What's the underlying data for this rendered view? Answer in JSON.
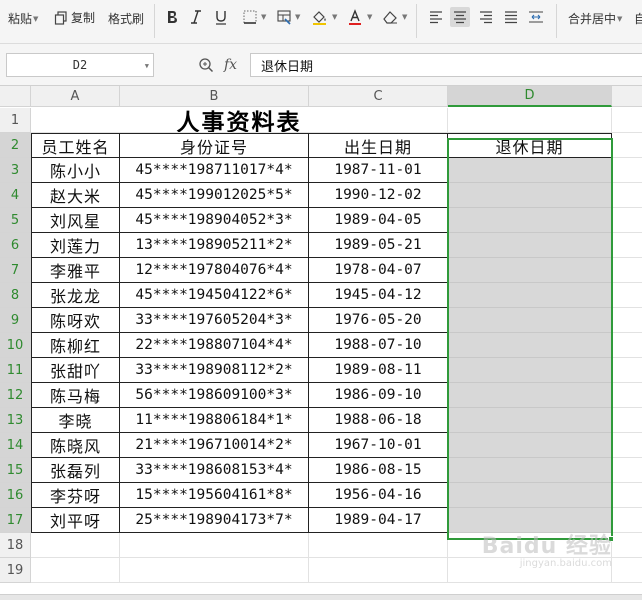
{
  "toolbar": {
    "paste_label": "粘贴",
    "copy_label": "复制",
    "format_painter_label": "格式刷",
    "merge_center_label": "合并居中",
    "overflow_label": "自"
  },
  "formula_bar": {
    "cell_ref": "D2",
    "fx_label": "fx",
    "content": "退休日期"
  },
  "columns": [
    "A",
    "B",
    "C",
    "D"
  ],
  "selected_column": "D",
  "rows": [
    "1",
    "2",
    "3",
    "4",
    "5",
    "6",
    "7",
    "8",
    "9",
    "10",
    "11",
    "12",
    "13",
    "14",
    "15",
    "16",
    "17",
    "18",
    "19"
  ],
  "sheet": {
    "title": "人事资料表",
    "headers": [
      "员工姓名",
      "身份证号",
      "出生日期",
      "退休日期"
    ],
    "records": [
      {
        "name": "陈小小",
        "id": "45****198711017*4*",
        "birth": "1987-11-01",
        "retire": ""
      },
      {
        "name": "赵大米",
        "id": "45****199012025*5*",
        "birth": "1990-12-02",
        "retire": ""
      },
      {
        "name": "刘风星",
        "id": "45****198904052*3*",
        "birth": "1989-04-05",
        "retire": ""
      },
      {
        "name": "刘莲力",
        "id": "13****198905211*2*",
        "birth": "1989-05-21",
        "retire": ""
      },
      {
        "name": "李雅平",
        "id": "12****197804076*4*",
        "birth": "1978-04-07",
        "retire": ""
      },
      {
        "name": "张龙龙",
        "id": "45****194504122*6*",
        "birth": "1945-04-12",
        "retire": ""
      },
      {
        "name": "陈呀欢",
        "id": "33****197605204*3*",
        "birth": "1976-05-20",
        "retire": ""
      },
      {
        "name": "陈柳红",
        "id": "22****198807104*4*",
        "birth": "1988-07-10",
        "retire": ""
      },
      {
        "name": "张甜吖",
        "id": "33****198908112*2*",
        "birth": "1989-08-11",
        "retire": ""
      },
      {
        "name": "陈马梅",
        "id": "56****198609100*3*",
        "birth": "1986-09-10",
        "retire": ""
      },
      {
        "name": "李晓",
        "id": "11****198806184*1*",
        "birth": "1988-06-18",
        "retire": ""
      },
      {
        "name": "陈晓风",
        "id": "21****196710014*2*",
        "birth": "1967-10-01",
        "retire": ""
      },
      {
        "name": "张磊列",
        "id": "33****198608153*4*",
        "birth": "1986-08-15",
        "retire": ""
      },
      {
        "name": "李芬呀",
        "id": "15****195604161*8*",
        "birth": "1956-04-16",
        "retire": ""
      },
      {
        "name": "刘平呀",
        "id": "25****198904173*7*",
        "birth": "1989-04-17",
        "retire": ""
      }
    ]
  },
  "watermark": {
    "logo": "Baidu 经验",
    "url": "jingyan.baidu.com"
  },
  "colors": {
    "selection": "#2f9a3a",
    "selected_fill": "#d8d8d8",
    "header_bg": "#f0f0f0"
  }
}
